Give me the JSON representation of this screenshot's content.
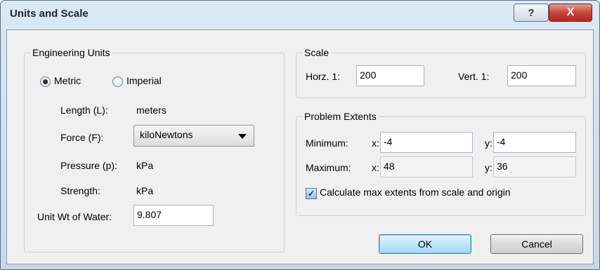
{
  "window": {
    "title": "Units and Scale",
    "help_glyph": "?",
    "close_glyph": "X"
  },
  "engineering_units": {
    "legend": "Engineering Units",
    "radio_metric": "Metric",
    "radio_imperial": "Imperial",
    "selected": "Metric",
    "length_label": "Length (L):",
    "length_value": "meters",
    "force_label": "Force (F):",
    "force_value": "kiloNewtons",
    "pressure_label": "Pressure (p):",
    "pressure_value": "kPa",
    "strength_label": "Strength:",
    "strength_value": "kPa",
    "unit_wt_label": "Unit Wt of Water:",
    "unit_wt_value": "9.807"
  },
  "scale": {
    "legend": "Scale",
    "horz_label": "Horz. 1:",
    "horz_value": "200",
    "vert_label": "Vert. 1:",
    "vert_value": "200"
  },
  "problem_extents": {
    "legend": "Problem Extents",
    "minimum_label": "Minimum:",
    "maximum_label": "Maximum:",
    "x_label": "x:",
    "y_label": "y:",
    "min_x": "-4",
    "min_y": "-4",
    "max_x": "48",
    "max_y": "36",
    "calc_label": "Calculate max extents from scale and origin",
    "calc_checked": true,
    "check_glyph": "✓"
  },
  "buttons": {
    "ok": "OK",
    "cancel": "Cancel"
  }
}
